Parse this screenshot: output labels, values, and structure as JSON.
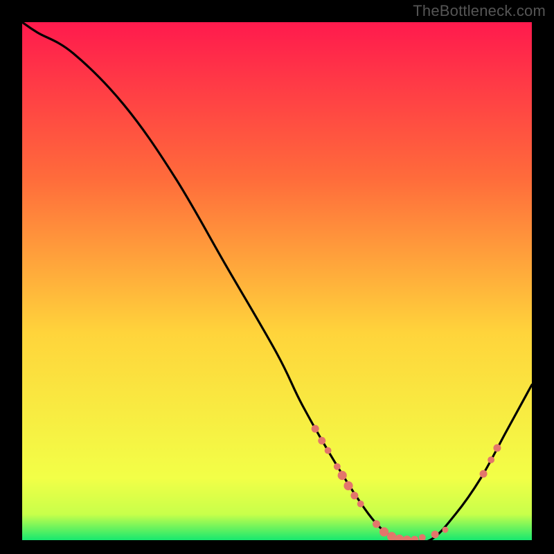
{
  "watermark": "TheBottleneck.com",
  "chart_data": {
    "type": "line",
    "title": "",
    "xlabel": "",
    "ylabel": "",
    "xlim": [
      0,
      100
    ],
    "ylim": [
      0,
      100
    ],
    "grid": false,
    "legend": false,
    "series": [
      {
        "name": "bottleneck-curve",
        "x": [
          0,
          3,
          10,
          20,
          30,
          40,
          50,
          55,
          62,
          68,
          72,
          75,
          80,
          85,
          90,
          95,
          100
        ],
        "values": [
          100,
          98,
          94,
          84,
          70,
          53,
          36,
          26,
          14,
          5,
          1,
          0,
          0,
          5,
          12,
          21,
          30
        ]
      }
    ],
    "markers": {
      "name": "highlighted-points",
      "color": "#e3766b",
      "points": [
        {
          "x": 57.5,
          "y": 21.5,
          "size": 10
        },
        {
          "x": 58.8,
          "y": 19.2,
          "size": 10
        },
        {
          "x": 60.0,
          "y": 17.3,
          "size": 9
        },
        {
          "x": 61.8,
          "y": 14.2,
          "size": 9
        },
        {
          "x": 62.8,
          "y": 12.5,
          "size": 12
        },
        {
          "x": 64.0,
          "y": 10.5,
          "size": 12
        },
        {
          "x": 65.2,
          "y": 8.6,
          "size": 10
        },
        {
          "x": 66.4,
          "y": 7.0,
          "size": 9
        },
        {
          "x": 69.5,
          "y": 3.1,
          "size": 10
        },
        {
          "x": 71.0,
          "y": 1.6,
          "size": 12
        },
        {
          "x": 72.5,
          "y": 0.7,
          "size": 12
        },
        {
          "x": 74.0,
          "y": 0.2,
          "size": 12
        },
        {
          "x": 75.5,
          "y": 0.0,
          "size": 12
        },
        {
          "x": 77.0,
          "y": 0.1,
          "size": 10
        },
        {
          "x": 78.5,
          "y": 0.5,
          "size": 9
        },
        {
          "x": 81.0,
          "y": 1.1,
          "size": 10
        },
        {
          "x": 83.0,
          "y": 2.0,
          "size": 8
        },
        {
          "x": 90.5,
          "y": 12.8,
          "size": 10
        },
        {
          "x": 92.0,
          "y": 15.5,
          "size": 9
        },
        {
          "x": 93.2,
          "y": 17.8,
          "size": 10
        }
      ]
    },
    "background_gradient": {
      "top_color": "#ff1a4d",
      "mid_color": "#ffe042",
      "bottom_color": "#17e86f",
      "green_band_start_pct": 95
    }
  }
}
